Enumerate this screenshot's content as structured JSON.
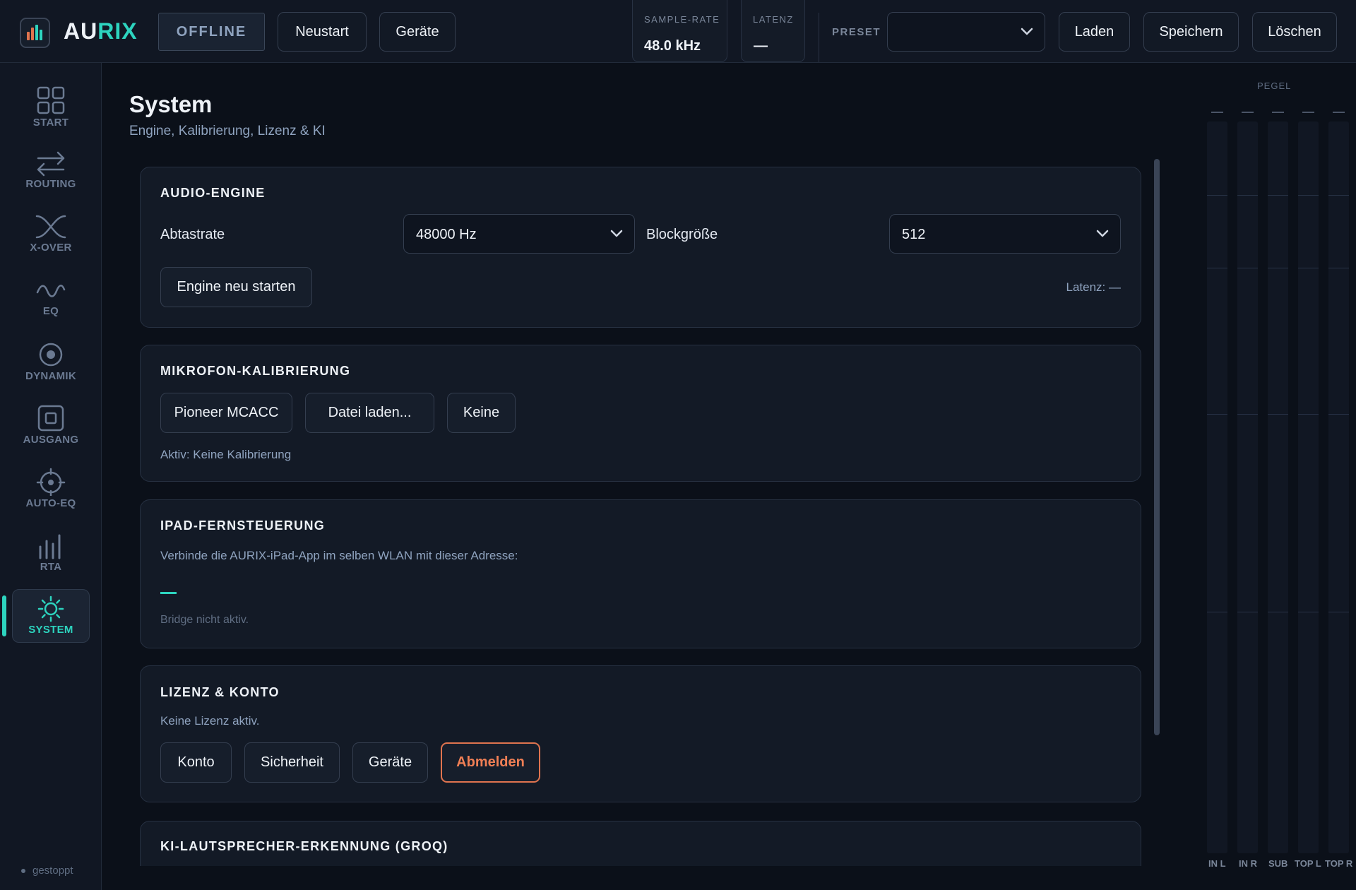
{
  "app": {
    "name_main": "AU",
    "name_accent": "RIX",
    "status": "OFFLINE",
    "accent_color": "#2dd4bf"
  },
  "topbar": {
    "restart_label": "Neustart",
    "devices_label": "Geräte",
    "sample_rate": {
      "label": "SAMPLE-RATE",
      "value": "48.0 kHz"
    },
    "latency": {
      "label": "LATENZ",
      "value": "—"
    },
    "preset": {
      "label": "PRESET",
      "selected": "",
      "load_label": "Laden",
      "save_label": "Speichern",
      "delete_label": "Löschen"
    }
  },
  "sidebar": {
    "items": [
      {
        "label": "START",
        "icon": "grid-icon"
      },
      {
        "label": "ROUTING",
        "icon": "arrows-swap-icon"
      },
      {
        "label": "X-OVER",
        "icon": "crossover-icon"
      },
      {
        "label": "EQ",
        "icon": "wave-icon"
      },
      {
        "label": "DYNAMIK",
        "icon": "target-icon"
      },
      {
        "label": "AUSGANG",
        "icon": "output-square-icon"
      },
      {
        "label": "AUTO-EQ",
        "icon": "crosshair-icon"
      },
      {
        "label": "RTA",
        "icon": "bars-icon"
      },
      {
        "label": "SYSTEM",
        "icon": "sun-gear-icon",
        "active": true
      }
    ],
    "status": "gestoppt"
  },
  "page": {
    "title": "System",
    "subtitle": "Engine, Kalibrierung, Lizenz & KI"
  },
  "audio_engine": {
    "title": "AUDIO-ENGINE",
    "samplerate_label": "Abtastrate",
    "samplerate_value": "48000 Hz",
    "blocksize_label": "Blockgröße",
    "blocksize_value": "512",
    "restart_button": "Engine neu starten",
    "latency_text": "Latenz: —"
  },
  "mic_calibration": {
    "title": "MIKROFON-KALIBRIERUNG",
    "buttons": [
      "Pioneer MCACC",
      "Datei laden...",
      "Keine"
    ],
    "active_text": "Aktiv: Keine Kalibrierung"
  },
  "ipad_remote": {
    "title": "IPAD-FERNSTEUERUNG",
    "description": "Verbinde die AURIX-iPad-App im selben WLAN mit dieser Adresse:",
    "bridge_status": "Bridge nicht aktiv."
  },
  "license": {
    "title": "LIZENZ & KONTO",
    "status": "Keine Lizenz aktiv.",
    "buttons": [
      "Konto",
      "Sicherheit",
      "Geräte"
    ],
    "logout": "Abmelden"
  },
  "ai_speaker": {
    "title": "KI-LAUTSPRECHER-ERKENNUNG (GROQ)"
  },
  "meters": {
    "title": "PEGEL",
    "channels": [
      "IN L",
      "IN R",
      "SUB",
      "TOP L",
      "TOP R"
    ],
    "peaks": [
      "—",
      "—",
      "—",
      "—",
      "—"
    ]
  }
}
